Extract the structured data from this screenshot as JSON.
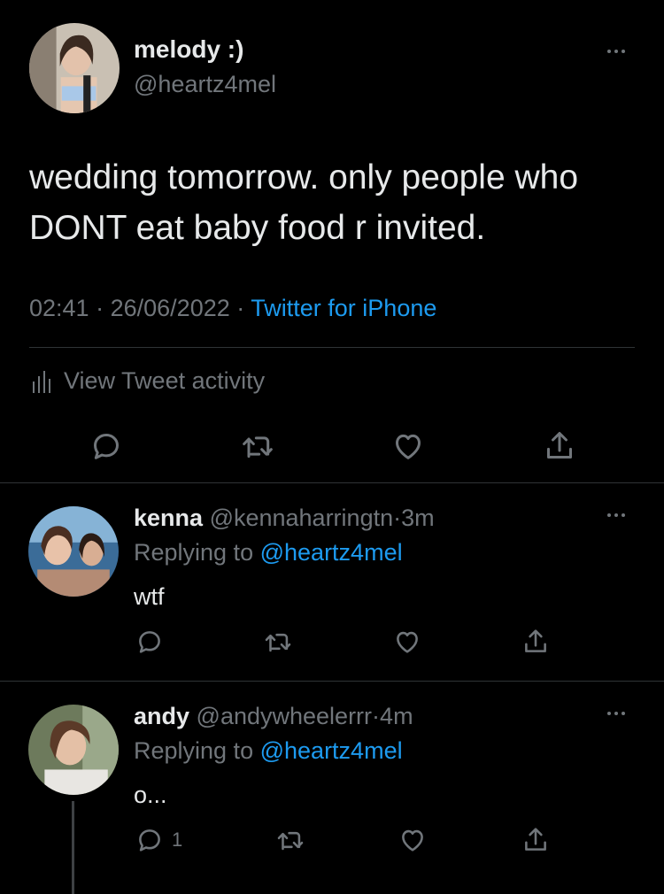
{
  "tweet": {
    "display_name": "melody :)",
    "handle": "@heartz4mel",
    "text": "wedding tomorrow. only people who DONT eat baby food r invited.",
    "time": "02:41",
    "date": "26/06/2022",
    "separator": "·",
    "source": "Twitter for iPhone",
    "activity_label": "View Tweet activity",
    "icons": [
      "reply-icon",
      "retweet-icon",
      "like-icon",
      "share-icon",
      "more-icon",
      "activity-icon"
    ]
  },
  "replies": [
    {
      "display_name": "kenna",
      "handle": "@kennaharringtn",
      "separator": "·",
      "time": "3m",
      "replying_prefix": "Replying to",
      "replying_to": "@heartz4mel",
      "text": "wtf",
      "reply_count": ""
    },
    {
      "display_name": "andy",
      "handle": "@andywheelerrr",
      "separator": "·",
      "time": "4m",
      "replying_prefix": "Replying to",
      "replying_to": "@heartz4mel",
      "text": "o...",
      "reply_count": "1"
    }
  ],
  "colors": {
    "background": "#000000",
    "primary_text": "#e7e9ea",
    "secondary_text": "#71767b",
    "link": "#1d9bf0",
    "divider": "#2f3336"
  }
}
